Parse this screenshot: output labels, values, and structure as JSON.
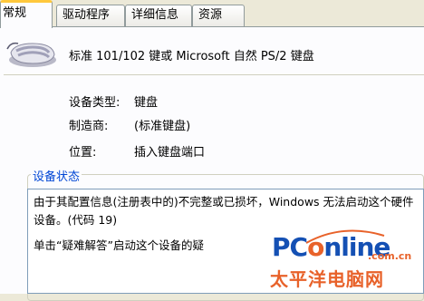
{
  "tabs": [
    {
      "label": "常规",
      "active": true
    },
    {
      "label": "驱动程序",
      "active": false
    },
    {
      "label": "详细信息",
      "active": false
    },
    {
      "label": "资源",
      "active": false
    }
  ],
  "device": {
    "icon": "keyboard-icon",
    "name": "标准 101/102 键或 Microsoft 自然 PS/2 键盘"
  },
  "properties": {
    "type_label": "设备类型:",
    "type_value": "键盘",
    "maker_label": "制造商:",
    "maker_value": "(标准键盘)",
    "location_label": "位置:",
    "location_value": "插入键盘端口"
  },
  "status": {
    "title": "设备状态",
    "line1": "由于其配置信息(注册表中的)不完整或已损坏，Windows 无法启动这个硬件设备。(代码 19)",
    "line2": "单击“疑难解答”启动这个设备的疑"
  },
  "watermark": {
    "logo_prefix": "PC",
    "logo_o": "o",
    "logo_suffix": "nline",
    "domain": ".com.cn",
    "chinese": "太平洋电脑网"
  },
  "colors": {
    "tab_highlight": "#ffc83c",
    "group_title": "#0046d5",
    "watermark_blue": "#1450b4",
    "watermark_orange": "#e8622a"
  }
}
